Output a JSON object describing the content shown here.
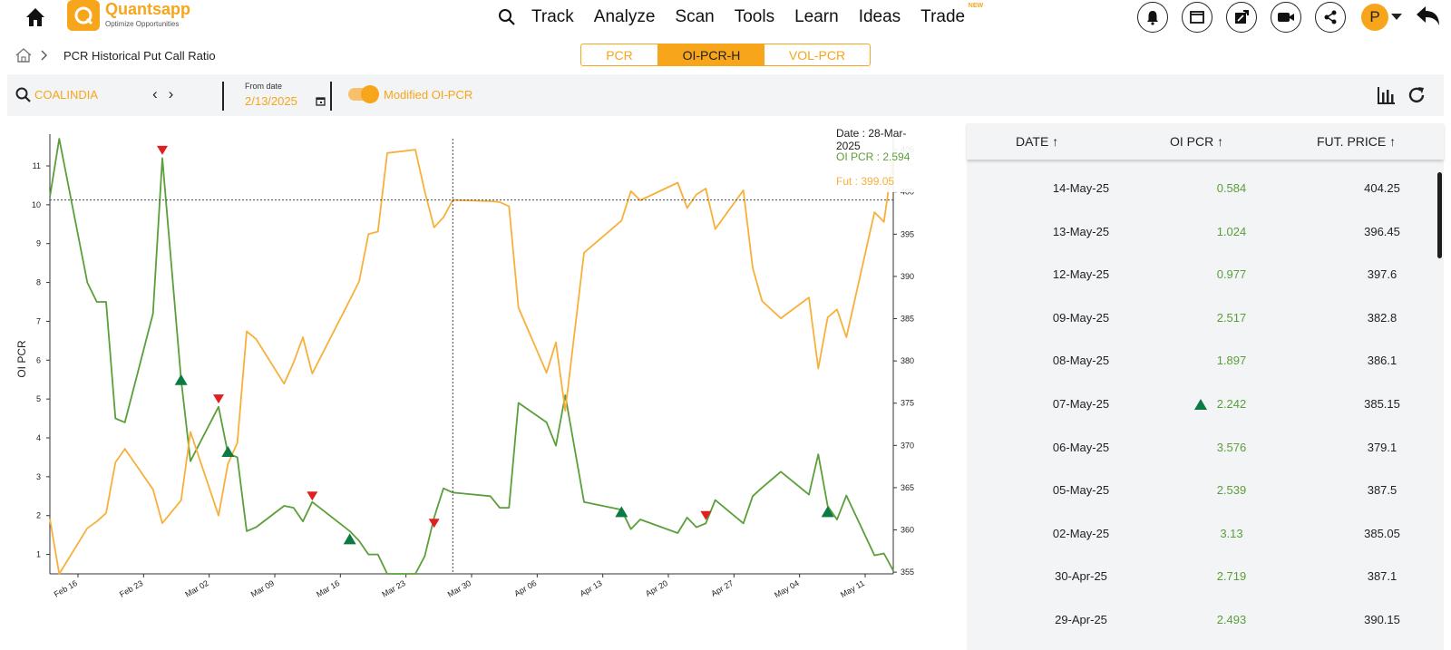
{
  "brand": {
    "name": "Quantsapp",
    "tagline": "Optimize Opportunities",
    "reg": "®"
  },
  "nav": {
    "items": [
      "Track",
      "Analyze",
      "Scan",
      "Tools",
      "Learn",
      "Ideas",
      "Trade"
    ],
    "trade_badge": "NEW"
  },
  "user": {
    "initial": "P"
  },
  "breadcrumb": {
    "title": "PCR Historical Put Call Ratio"
  },
  "tabs": [
    "PCR",
    "OI-PCR-H",
    "VOL-PCR"
  ],
  "toolbar": {
    "symbol": "COALINDIA",
    "from_label": "From date",
    "from_value": "2/13/2025",
    "toggle_label": "Modified OI-PCR"
  },
  "colors": {
    "accent": "#f7a51b",
    "oi_pcr": "#5a9f3a",
    "fut": "#f7b03a",
    "up_marker": "#0e7a43",
    "down_marker": "#e02020"
  },
  "tooltip": {
    "date": "Date : 28-Mar-2025",
    "oi_pcr": "OI PCR : 2.594",
    "fut": "Fut : 399.05"
  },
  "chart_data": {
    "type": "line",
    "ylabel": "OI PCR",
    "x_ticks": [
      "Feb 16",
      "Feb 23",
      "Mar 02",
      "Mar 09",
      "Mar 16",
      "Mar 23",
      "Mar 30",
      "Apr 06",
      "Apr 13",
      "Apr 20",
      "Apr 27",
      "May 04",
      "May 11"
    ],
    "y_left_ticks": [
      1,
      2,
      3,
      4,
      5,
      6,
      7,
      8,
      9,
      10,
      11
    ],
    "y_right_ticks": [
      355,
      360,
      365,
      370,
      375,
      380,
      385,
      390,
      395,
      400,
      405
    ],
    "ylim_left": [
      0.5,
      11.7
    ],
    "ylim_right": [
      354.8,
      406.3
    ],
    "grid": false,
    "series": [
      {
        "name": "OI PCR",
        "axis": "left",
        "points": [
          [
            "2025-02-13",
            10.2
          ],
          [
            "2025-02-14",
            11.7
          ],
          [
            "2025-02-17",
            8.0
          ],
          [
            "2025-02-18",
            7.5
          ],
          [
            "2025-02-19",
            7.5
          ],
          [
            "2025-02-20",
            4.5
          ],
          [
            "2025-02-21",
            4.4
          ],
          [
            "2025-02-24",
            7.2
          ],
          [
            "2025-02-25",
            11.2
          ],
          [
            "2025-02-27",
            5.5
          ],
          [
            "2025-02-28",
            3.4
          ],
          [
            "2025-03-03",
            4.8
          ],
          [
            "2025-03-04",
            3.6
          ],
          [
            "2025-03-05",
            3.5
          ],
          [
            "2025-03-06",
            1.6
          ],
          [
            "2025-03-07",
            1.7
          ],
          [
            "2025-03-10",
            2.25
          ],
          [
            "2025-03-11",
            2.2
          ],
          [
            "2025-03-12",
            1.85
          ],
          [
            "2025-03-13",
            2.35
          ],
          [
            "2025-03-17",
            1.6
          ],
          [
            "2025-03-18",
            1.35
          ],
          [
            "2025-03-19",
            1.0
          ],
          [
            "2025-03-20",
            1.0
          ],
          [
            "2025-03-21",
            0.5
          ],
          [
            "2025-03-24",
            0.5
          ],
          [
            "2025-03-25",
            0.95
          ],
          [
            "2025-03-26",
            1.95
          ],
          [
            "2025-03-27",
            2.7
          ],
          [
            "2025-03-28",
            2.594
          ],
          [
            "2025-04-01",
            2.5
          ],
          [
            "2025-04-02",
            2.2
          ],
          [
            "2025-04-03",
            2.2
          ],
          [
            "2025-04-04",
            4.9
          ],
          [
            "2025-04-07",
            4.4
          ],
          [
            "2025-04-08",
            3.8
          ],
          [
            "2025-04-09",
            5.1
          ],
          [
            "2025-04-11",
            2.35
          ],
          [
            "2025-04-15",
            2.15
          ],
          [
            "2025-04-16",
            1.65
          ],
          [
            "2025-04-17",
            1.9
          ],
          [
            "2025-04-21",
            1.55
          ],
          [
            "2025-04-22",
            1.95
          ],
          [
            "2025-04-23",
            1.7
          ],
          [
            "2025-04-24",
            1.8
          ],
          [
            "2025-04-25",
            2.4
          ],
          [
            "2025-04-28",
            1.8
          ],
          [
            "2025-04-29",
            2.5
          ],
          [
            "2025-04-30",
            2.719
          ],
          [
            "2025-05-02",
            3.13
          ],
          [
            "2025-05-05",
            2.539
          ],
          [
            "2025-05-06",
            3.576
          ],
          [
            "2025-05-07",
            2.242
          ],
          [
            "2025-05-08",
            1.897
          ],
          [
            "2025-05-09",
            2.517
          ],
          [
            "2025-05-12",
            0.977
          ],
          [
            "2025-05-13",
            1.024
          ],
          [
            "2025-05-14",
            0.584
          ]
        ]
      },
      {
        "name": "Fut",
        "axis": "right",
        "points": [
          [
            "2025-02-13",
            361.3
          ],
          [
            "2025-02-14",
            354.8
          ],
          [
            "2025-02-17",
            360.2
          ],
          [
            "2025-02-18",
            361.0
          ],
          [
            "2025-02-19",
            362.0
          ],
          [
            "2025-02-20",
            368.0
          ],
          [
            "2025-02-21",
            369.6
          ],
          [
            "2025-02-24",
            364.8
          ],
          [
            "2025-02-25",
            360.8
          ],
          [
            "2025-02-27",
            363.5
          ],
          [
            "2025-02-28",
            371.6
          ],
          [
            "2025-03-03",
            361.7
          ],
          [
            "2025-03-04",
            367.8
          ],
          [
            "2025-03-05",
            370.3
          ],
          [
            "2025-03-06",
            383.5
          ],
          [
            "2025-03-07",
            382.6
          ],
          [
            "2025-03-10",
            377.3
          ],
          [
            "2025-03-11",
            379.8
          ],
          [
            "2025-03-12",
            382.8
          ],
          [
            "2025-03-13",
            378.5
          ],
          [
            "2025-03-17",
            387.2
          ],
          [
            "2025-03-18",
            389.4
          ],
          [
            "2025-03-19",
            395.0
          ],
          [
            "2025-03-20",
            395.3
          ],
          [
            "2025-03-21",
            404.6
          ],
          [
            "2025-03-24",
            405.0
          ],
          [
            "2025-03-25",
            400.1
          ],
          [
            "2025-03-26",
            395.8
          ],
          [
            "2025-03-27",
            397.0
          ],
          [
            "2025-03-28",
            399.05
          ],
          [
            "2025-04-01",
            398.9
          ],
          [
            "2025-04-02",
            398.8
          ],
          [
            "2025-04-03",
            398.3
          ],
          [
            "2025-04-04",
            386.3
          ],
          [
            "2025-04-07",
            378.6
          ],
          [
            "2025-04-08",
            382.2
          ],
          [
            "2025-04-09",
            374.1
          ],
          [
            "2025-04-11",
            392.8
          ],
          [
            "2025-04-15",
            396.6
          ],
          [
            "2025-04-16",
            400.1
          ],
          [
            "2025-04-17",
            399.0
          ],
          [
            "2025-04-21",
            401.1
          ],
          [
            "2025-04-22",
            398.1
          ],
          [
            "2025-04-23",
            399.7
          ],
          [
            "2025-04-24",
            400.4
          ],
          [
            "2025-04-25",
            395.6
          ],
          [
            "2025-04-28",
            400.2
          ],
          [
            "2025-04-29",
            391.0
          ],
          [
            "2025-04-30",
            387.1
          ],
          [
            "2025-05-02",
            385.05
          ],
          [
            "2025-05-05",
            387.5
          ],
          [
            "2025-05-06",
            379.1
          ],
          [
            "2025-05-07",
            385.15
          ],
          [
            "2025-05-08",
            386.1
          ],
          [
            "2025-05-09",
            382.8
          ],
          [
            "2025-05-12",
            397.6
          ],
          [
            "2025-05-13",
            396.45
          ],
          [
            "2025-05-14",
            404.25
          ]
        ]
      }
    ],
    "markers": [
      {
        "date": "2025-02-25",
        "value": 11.4,
        "dir": "down"
      },
      {
        "date": "2025-02-27",
        "value": 5.5,
        "dir": "up"
      },
      {
        "date": "2025-03-03",
        "value": 5.0,
        "dir": "down"
      },
      {
        "date": "2025-03-04",
        "value": 3.65,
        "dir": "up"
      },
      {
        "date": "2025-03-13",
        "value": 2.5,
        "dir": "down"
      },
      {
        "date": "2025-03-17",
        "value": 1.4,
        "dir": "up"
      },
      {
        "date": "2025-03-26",
        "value": 1.8,
        "dir": "down"
      },
      {
        "date": "2025-04-15",
        "value": 2.1,
        "dir": "up"
      },
      {
        "date": "2025-04-24",
        "value": 2.0,
        "dir": "down"
      },
      {
        "date": "2025-05-07",
        "value": 2.1,
        "dir": "up"
      }
    ],
    "crosshair": {
      "date": "2025-03-28",
      "fut": 399.05
    }
  },
  "table": {
    "headers": [
      "DATE",
      "OI PCR",
      "FUT. PRICE"
    ],
    "rows": [
      {
        "date": "14-May-25",
        "oi_pcr": "0.584",
        "fut": "404.25"
      },
      {
        "date": "13-May-25",
        "oi_pcr": "1.024",
        "fut": "396.45"
      },
      {
        "date": "12-May-25",
        "oi_pcr": "0.977",
        "fut": "397.6"
      },
      {
        "date": "09-May-25",
        "oi_pcr": "2.517",
        "fut": "382.8"
      },
      {
        "date": "08-May-25",
        "oi_pcr": "1.897",
        "fut": "386.1"
      },
      {
        "date": "07-May-25",
        "oi_pcr": "2.242",
        "fut": "385.15",
        "signal": "up"
      },
      {
        "date": "06-May-25",
        "oi_pcr": "3.576",
        "fut": "379.1"
      },
      {
        "date": "05-May-25",
        "oi_pcr": "2.539",
        "fut": "387.5"
      },
      {
        "date": "02-May-25",
        "oi_pcr": "3.13",
        "fut": "385.05"
      },
      {
        "date": "30-Apr-25",
        "oi_pcr": "2.719",
        "fut": "387.1"
      },
      {
        "date": "29-Apr-25",
        "oi_pcr": "2.493",
        "fut": "390.15"
      }
    ]
  }
}
